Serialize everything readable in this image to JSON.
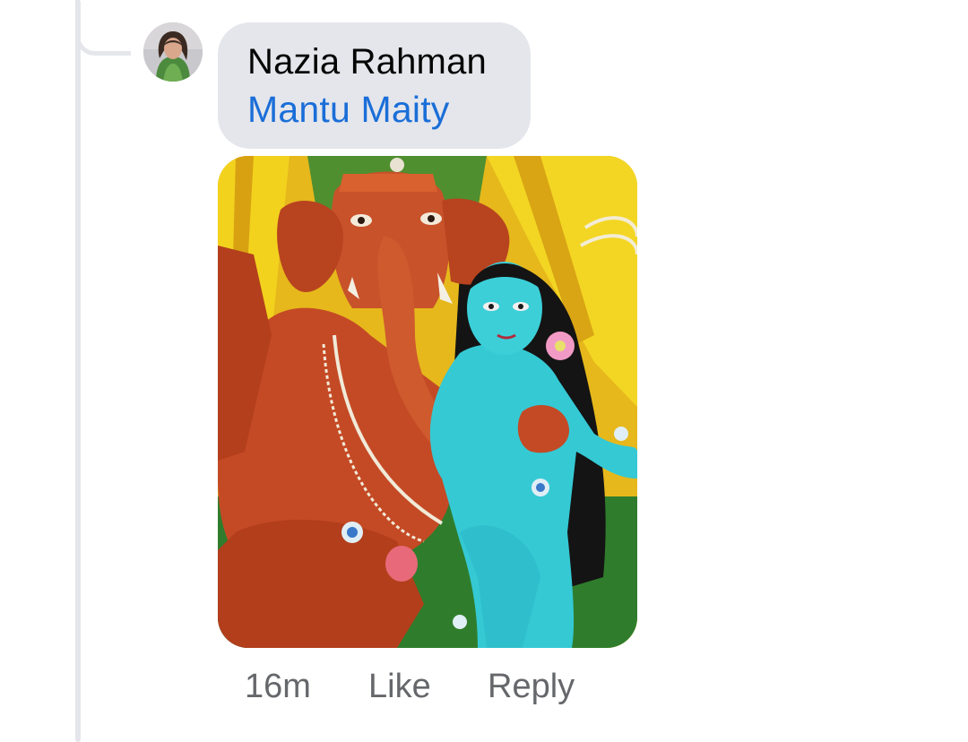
{
  "comment": {
    "author": "Nazia Rahman",
    "mention": "Mantu Maity",
    "attachment": {
      "type": "photo",
      "subject": "painted idol sculptures"
    },
    "actions": {
      "timestamp": "16m",
      "like_label": "Like",
      "reply_label": "Reply"
    }
  },
  "colors": {
    "bubble_background": "#e4e6eb",
    "mention_link": "#1a6ed8",
    "meta_text": "#65676b",
    "thread_line": "#e4e6eb"
  }
}
